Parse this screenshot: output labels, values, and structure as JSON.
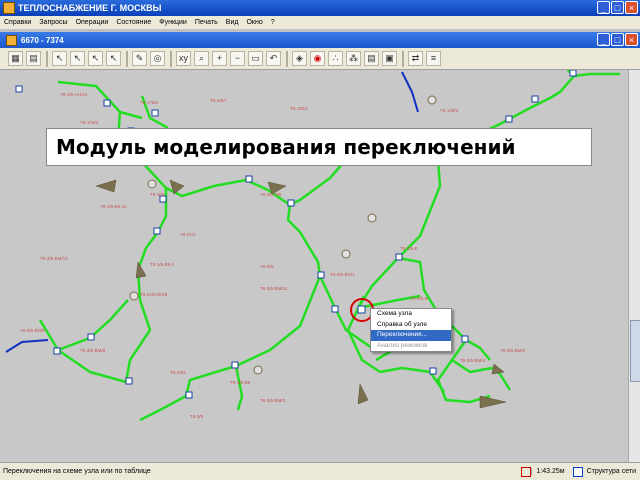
{
  "window": {
    "title": "ТЕПЛОСНАБЖЕНИЕ Г. МОСКВЫ"
  },
  "menu": [
    "Справки",
    "Запросы",
    "Операции",
    "Состояние",
    "Функции",
    "Печать",
    "Вид",
    "Окно",
    "?"
  ],
  "inner_window": {
    "title": "6670 - 7374"
  },
  "toolbar": [
    "select-icon",
    "select-icon",
    "select-icon",
    "select-icon",
    "pencil-icon",
    "binoculars-icon",
    "zoom-in-icon",
    "zoom-out-icon",
    "refresh-icon"
  ],
  "banner": {
    "text": "Модуль моделирования переключений"
  },
  "context_menu": {
    "items": [
      {
        "label": "Схема узла",
        "state": "normal"
      },
      {
        "label": "Справка об узле",
        "state": "normal"
      },
      {
        "label": "Переключения...",
        "state": "highlighted"
      },
      {
        "label": "Анализ режимов",
        "state": "disabled"
      }
    ]
  },
  "status": {
    "message": "Переключения на схеме узла или по таблице",
    "time": "1:43.25м",
    "structure_label": "Структура сети"
  },
  "colors": {
    "pipe": "#22dd22",
    "pipe_outline": "#0a8a0a",
    "feeder": "#1030c0",
    "marker": "#d40000",
    "label_text": "#c85050",
    "arrow": "#7a7050"
  }
}
